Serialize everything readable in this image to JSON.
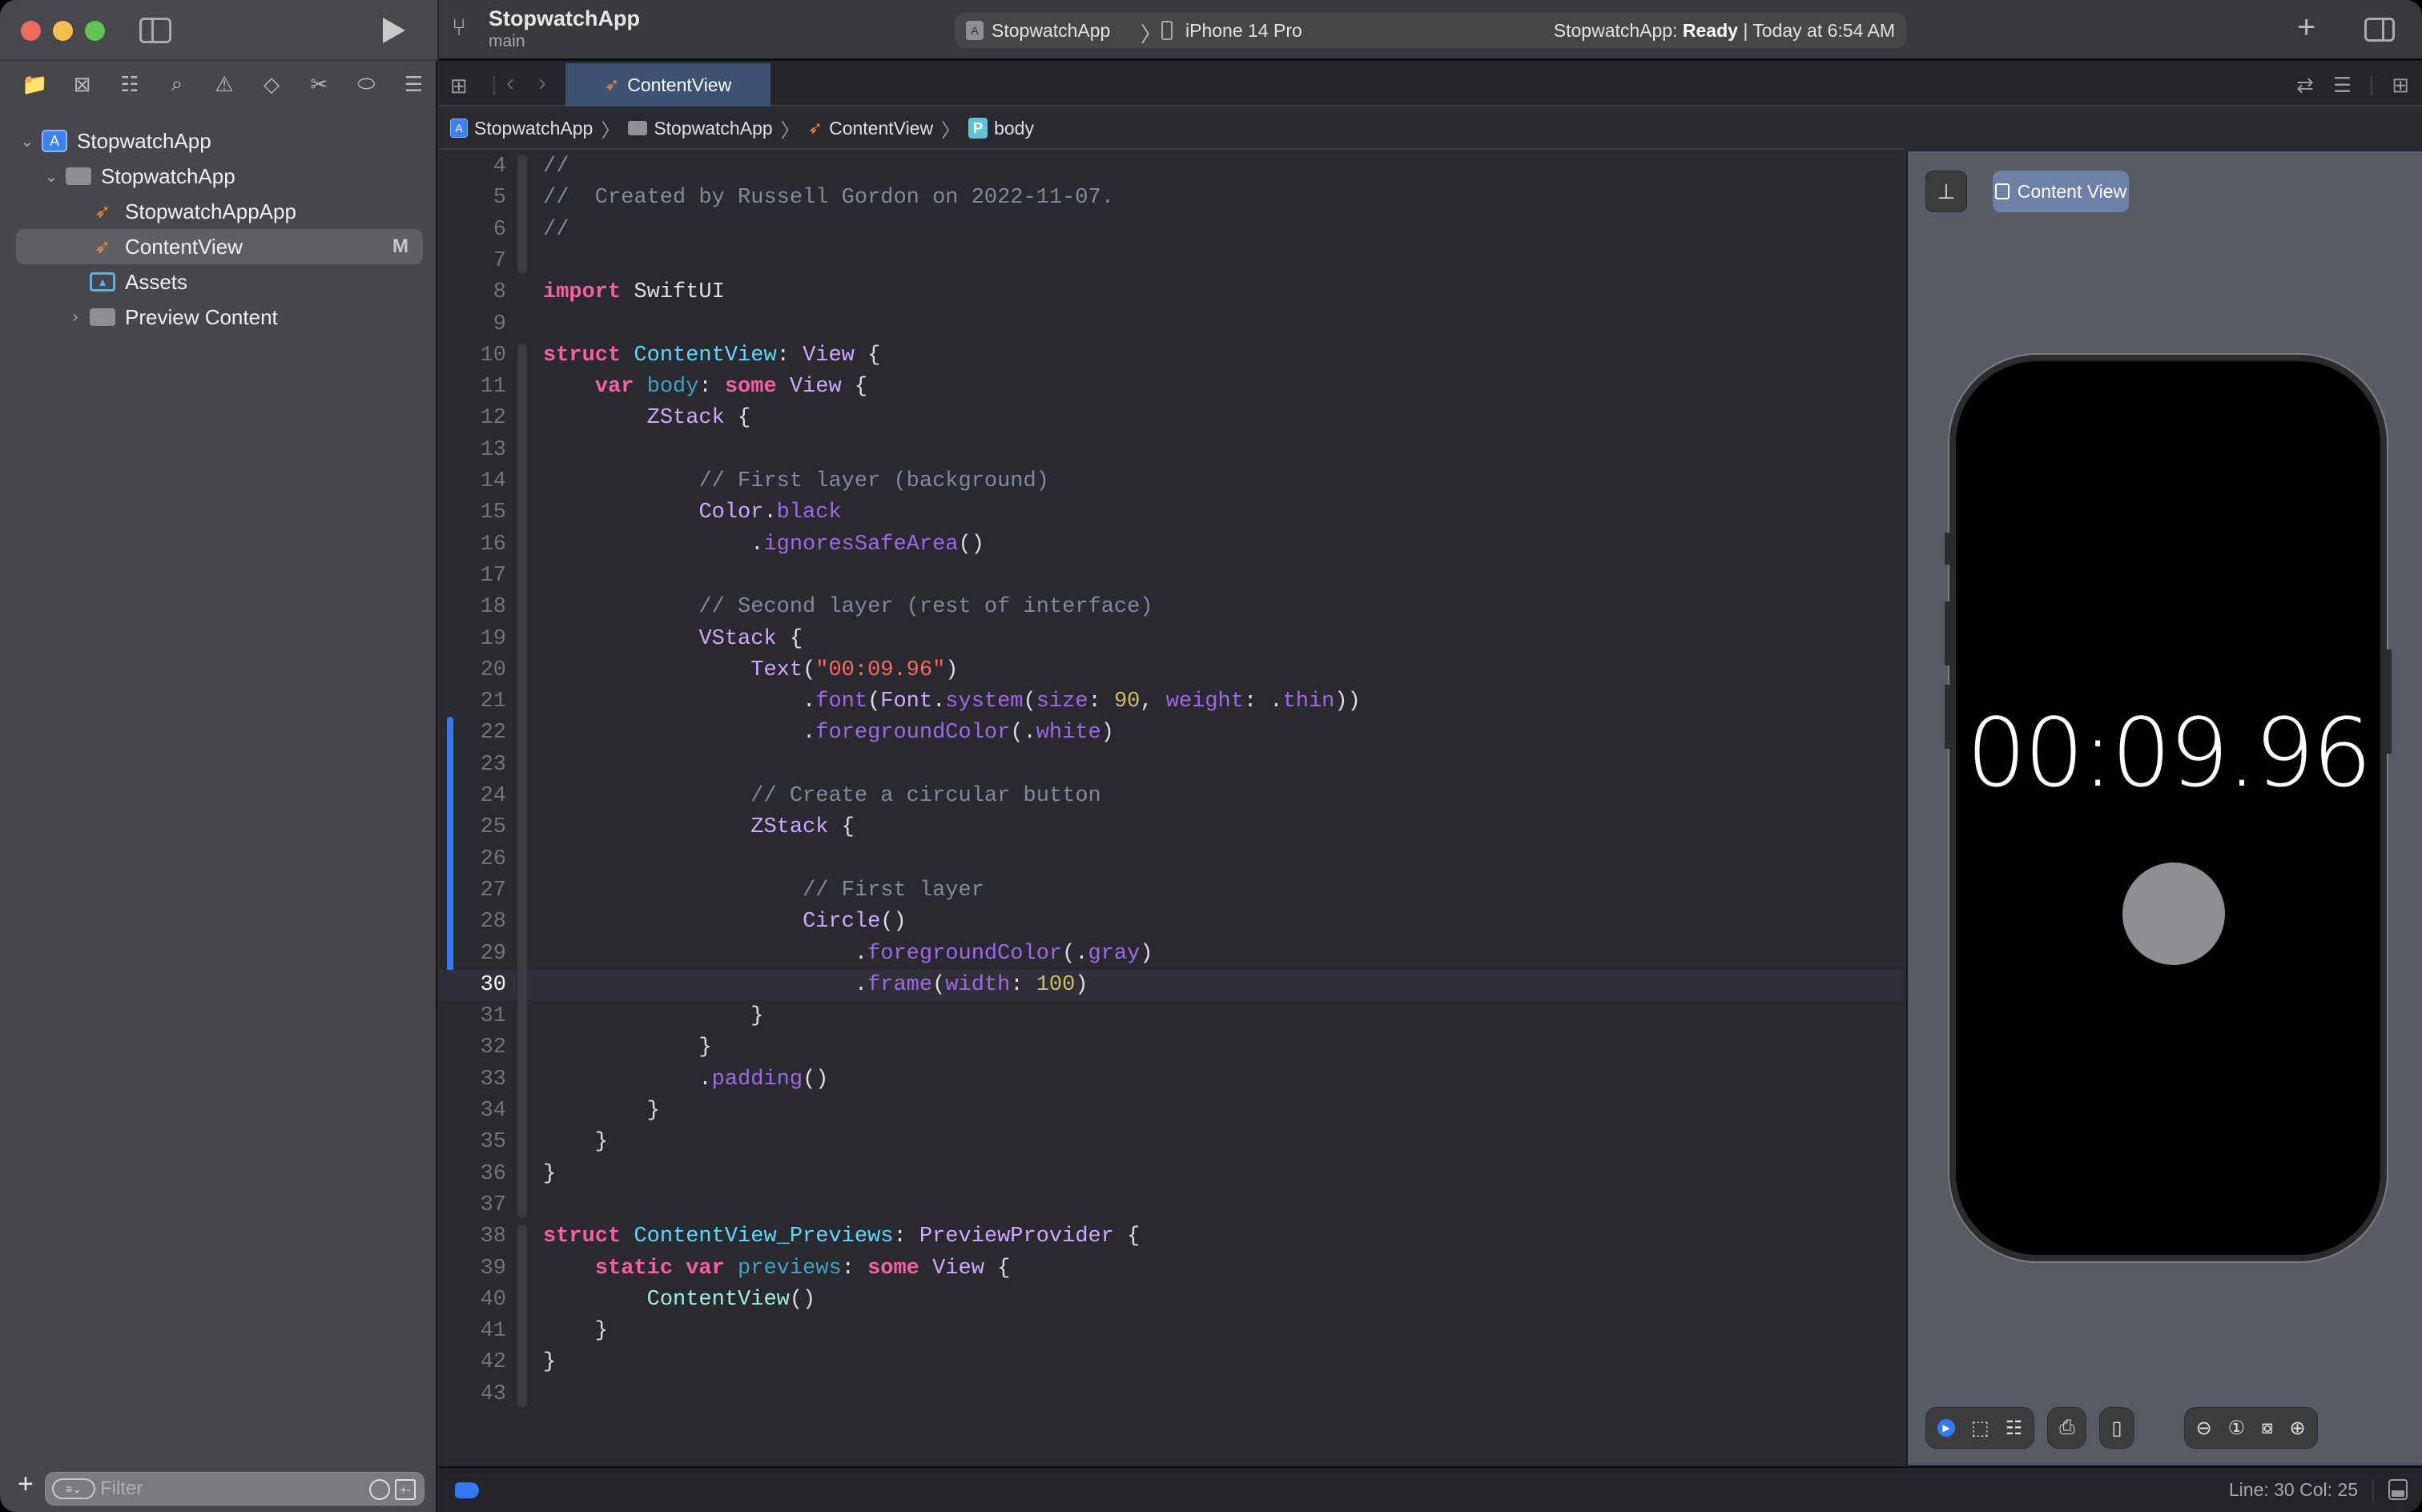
{
  "window": {
    "run_icon": "play-icon",
    "sidebar_toggle_icon": "sidebar-left-icon"
  },
  "toolbar": {
    "project_title": "StopwatchApp",
    "branch": "main",
    "scheme": {
      "app": "StopwatchApp",
      "separator": "〉",
      "device": "iPhone 14 Pro"
    },
    "status": {
      "prefix": "StopwatchApp: ",
      "state": "Ready",
      "suffix": " | Today at 6:54 AM"
    },
    "add_icon": "+",
    "inspector_icon": "sidebar-right-icon"
  },
  "navigator": {
    "tabs": [
      {
        "name": "project-navigator",
        "glyph": "📁",
        "active": true
      },
      {
        "name": "source-control-navigator",
        "glyph": "⊠"
      },
      {
        "name": "symbol-navigator",
        "glyph": "☷"
      },
      {
        "name": "find-navigator",
        "glyph": "⌕"
      },
      {
        "name": "issue-navigator",
        "glyph": "⚠"
      },
      {
        "name": "test-navigator",
        "glyph": "◇"
      },
      {
        "name": "debug-navigator",
        "glyph": "✂"
      },
      {
        "name": "breakpoint-navigator",
        "glyph": "⬭"
      },
      {
        "name": "report-navigator",
        "glyph": "☰"
      }
    ],
    "tree": [
      {
        "label": "StopwatchApp",
        "type": "project",
        "indent": 0,
        "expanded": true
      },
      {
        "label": "StopwatchApp",
        "type": "folder",
        "indent": 1,
        "expanded": true
      },
      {
        "label": "StopwatchAppApp",
        "type": "swift",
        "indent": 2
      },
      {
        "label": "ContentView",
        "type": "swift",
        "indent": 2,
        "selected": true,
        "badge": "M"
      },
      {
        "label": "Assets",
        "type": "assets",
        "indent": 2
      },
      {
        "label": "Preview Content",
        "type": "folder",
        "indent": 2,
        "expanded": false
      }
    ],
    "filter_placeholder": "Filter",
    "add_label": "+"
  },
  "tabbar": {
    "active_tab": "ContentView",
    "back": "‹",
    "forward": "›"
  },
  "breadcrumb": [
    {
      "label": "StopwatchApp",
      "icon": "app"
    },
    {
      "label": "StopwatchApp",
      "icon": "folder"
    },
    {
      "label": "ContentView",
      "icon": "swift"
    },
    {
      "label": "body",
      "icon": "property",
      "icon_letter": "P"
    }
  ],
  "editor": {
    "current_line": 30,
    "lines": [
      {
        "n": 4,
        "tokens": [
          [
            "cm",
            "//"
          ]
        ]
      },
      {
        "n": 5,
        "tokens": [
          [
            "cm",
            "//  Created by Russell Gordon on 2022-11-07."
          ]
        ]
      },
      {
        "n": 6,
        "tokens": [
          [
            "cm",
            "//"
          ]
        ]
      },
      {
        "n": 7,
        "tokens": []
      },
      {
        "n": 8,
        "tokens": [
          [
            "kw",
            "import"
          ],
          [
            "pl",
            " SwiftUI"
          ]
        ]
      },
      {
        "n": 9,
        "tokens": []
      },
      {
        "n": 10,
        "tokens": [
          [
            "kw",
            "struct"
          ],
          [
            "pl",
            " "
          ],
          [
            "ty2",
            "ContentView"
          ],
          [
            "pl",
            ": "
          ],
          [
            "ty",
            "View"
          ],
          [
            "pl",
            " {"
          ]
        ]
      },
      {
        "n": 11,
        "tokens": [
          [
            "pl",
            "    "
          ],
          [
            "kw",
            "var"
          ],
          [
            "pl",
            " "
          ],
          [
            "prop",
            "body"
          ],
          [
            "pl",
            ": "
          ],
          [
            "kw",
            "some"
          ],
          [
            "pl",
            " "
          ],
          [
            "ty",
            "View"
          ],
          [
            "pl",
            " {"
          ]
        ]
      },
      {
        "n": 12,
        "tokens": [
          [
            "pl",
            "        "
          ],
          [
            "ty",
            "ZStack"
          ],
          [
            "pl",
            " {"
          ]
        ]
      },
      {
        "n": 13,
        "tokens": []
      },
      {
        "n": 14,
        "tokens": [
          [
            "pl",
            "            "
          ],
          [
            "cm",
            "// First layer (background)"
          ]
        ]
      },
      {
        "n": 15,
        "tokens": [
          [
            "pl",
            "            "
          ],
          [
            "ty",
            "Color"
          ],
          [
            "pl",
            "."
          ],
          [
            "fn",
            "black"
          ]
        ]
      },
      {
        "n": 16,
        "tokens": [
          [
            "pl",
            "                ."
          ],
          [
            "fn",
            "ignoresSafeArea"
          ],
          [
            "pl",
            "()"
          ]
        ]
      },
      {
        "n": 17,
        "tokens": []
      },
      {
        "n": 18,
        "tokens": [
          [
            "pl",
            "            "
          ],
          [
            "cm",
            "// Second layer (rest of interface)"
          ]
        ]
      },
      {
        "n": 19,
        "tokens": [
          [
            "pl",
            "            "
          ],
          [
            "ty",
            "VStack"
          ],
          [
            "pl",
            " {"
          ]
        ]
      },
      {
        "n": 20,
        "tokens": [
          [
            "pl",
            "                "
          ],
          [
            "ty",
            "Text"
          ],
          [
            "pl",
            "("
          ],
          [
            "str",
            "\"00:09.96\""
          ],
          [
            "pl",
            ")"
          ]
        ]
      },
      {
        "n": 21,
        "tokens": [
          [
            "pl",
            "                    ."
          ],
          [
            "fn",
            "font"
          ],
          [
            "pl",
            "("
          ],
          [
            "ty",
            "Font"
          ],
          [
            "pl",
            "."
          ],
          [
            "fn",
            "system"
          ],
          [
            "pl",
            "("
          ],
          [
            "fn",
            "size"
          ],
          [
            "pl",
            ": "
          ],
          [
            "num",
            "90"
          ],
          [
            "pl",
            ", "
          ],
          [
            "fn",
            "weight"
          ],
          [
            "pl",
            ": ."
          ],
          [
            "fn",
            "thin"
          ],
          [
            "pl",
            "))"
          ]
        ]
      },
      {
        "n": 22,
        "tokens": [
          [
            "pl",
            "                    ."
          ],
          [
            "fn",
            "foregroundColor"
          ],
          [
            "pl",
            "(."
          ],
          [
            "fn",
            "white"
          ],
          [
            "pl",
            ")"
          ]
        ]
      },
      {
        "n": 23,
        "tokens": []
      },
      {
        "n": 24,
        "tokens": [
          [
            "pl",
            "                "
          ],
          [
            "cm",
            "// Create a circular button"
          ]
        ]
      },
      {
        "n": 25,
        "tokens": [
          [
            "pl",
            "                "
          ],
          [
            "ty",
            "ZStack"
          ],
          [
            "pl",
            " {"
          ]
        ]
      },
      {
        "n": 26,
        "tokens": []
      },
      {
        "n": 27,
        "tokens": [
          [
            "pl",
            "                    "
          ],
          [
            "cm",
            "// First layer"
          ]
        ]
      },
      {
        "n": 28,
        "tokens": [
          [
            "pl",
            "                    "
          ],
          [
            "ty",
            "Circle"
          ],
          [
            "pl",
            "()"
          ]
        ]
      },
      {
        "n": 29,
        "tokens": [
          [
            "pl",
            "                        ."
          ],
          [
            "fn",
            "foregroundColor"
          ],
          [
            "pl",
            "(."
          ],
          [
            "fn",
            "gray"
          ],
          [
            "pl",
            ")"
          ]
        ]
      },
      {
        "n": 30,
        "tokens": [
          [
            "pl",
            "                        ."
          ],
          [
            "fn",
            "frame"
          ],
          [
            "pl",
            "("
          ],
          [
            "fn",
            "width"
          ],
          [
            "pl",
            ": "
          ],
          [
            "num",
            "100"
          ],
          [
            "pl",
            ")"
          ]
        ]
      },
      {
        "n": 31,
        "tokens": [
          [
            "pl",
            "                }"
          ]
        ]
      },
      {
        "n": 32,
        "tokens": [
          [
            "pl",
            "            }"
          ]
        ]
      },
      {
        "n": 33,
        "tokens": [
          [
            "pl",
            "            ."
          ],
          [
            "fn",
            "padding"
          ],
          [
            "pl",
            "()"
          ]
        ]
      },
      {
        "n": 34,
        "tokens": [
          [
            "pl",
            "        }"
          ]
        ]
      },
      {
        "n": 35,
        "tokens": [
          [
            "pl",
            "    }"
          ]
        ]
      },
      {
        "n": 36,
        "tokens": [
          [
            "pl",
            "}"
          ]
        ]
      },
      {
        "n": 37,
        "tokens": []
      },
      {
        "n": 38,
        "tokens": [
          [
            "kw",
            "struct"
          ],
          [
            "pl",
            " "
          ],
          [
            "ty2",
            "ContentView_Previews"
          ],
          [
            "pl",
            ": "
          ],
          [
            "ty",
            "PreviewProvider"
          ],
          [
            "pl",
            " {"
          ]
        ]
      },
      {
        "n": 39,
        "tokens": [
          [
            "pl",
            "    "
          ],
          [
            "kw",
            "static"
          ],
          [
            "pl",
            " "
          ],
          [
            "kw",
            "var"
          ],
          [
            "pl",
            " "
          ],
          [
            "prop",
            "previews"
          ],
          [
            "pl",
            ": "
          ],
          [
            "kw",
            "some"
          ],
          [
            "pl",
            " "
          ],
          [
            "ty",
            "View"
          ],
          [
            "pl",
            " {"
          ]
        ]
      },
      {
        "n": 40,
        "tokens": [
          [
            "pl",
            "        "
          ],
          [
            "cls",
            "ContentView"
          ],
          [
            "pl",
            "()"
          ]
        ]
      },
      {
        "n": 41,
        "tokens": [
          [
            "pl",
            "    }"
          ]
        ]
      },
      {
        "n": 42,
        "tokens": [
          [
            "pl",
            "}"
          ]
        ]
      },
      {
        "n": 43,
        "tokens": []
      }
    ]
  },
  "canvas": {
    "pin_icon": "📌",
    "preview_label": "Content View",
    "device_screen": {
      "timer_text": "00:09.96",
      "circle_color": "#8e8e93",
      "background": "#000000"
    },
    "controls": {
      "live_label": "▶",
      "select_label": "⬚",
      "variants_label": "☷",
      "settings_label": "⎙",
      "device_label": "▯",
      "zoom_out": "⊖",
      "zoom_actual": "①",
      "zoom_fit": "⧇",
      "zoom_in": "⊕"
    }
  },
  "statusbar": {
    "cursor_position": "Line: 30  Col: 25"
  },
  "colors": {
    "accent": "#3478f6",
    "keyword": "#fc5fa3",
    "comment": "#7f8c98",
    "type": "#d0a8ff",
    "string": "#fc6a5d",
    "number": "#d0bf69",
    "swift_orange": "#f28b38"
  }
}
